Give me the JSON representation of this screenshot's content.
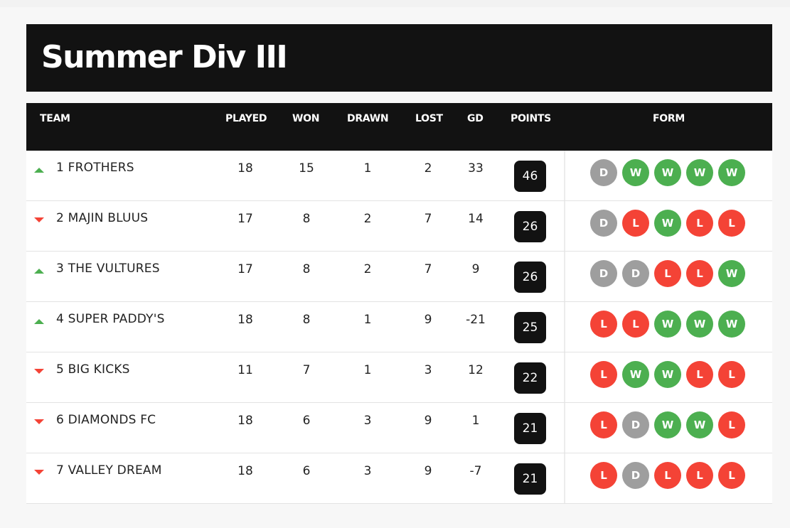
{
  "title": "Summer Div III",
  "headers": {
    "team": "TEAM",
    "played": "PLAYED",
    "won": "WON",
    "drawn": "DRAWN",
    "lost": "LOST",
    "gd": "GD",
    "points": "POINTS",
    "form": "FORM"
  },
  "colors": {
    "header_bg": "#121212",
    "win": "#4caf50",
    "loss": "#f44336",
    "draw": "#9e9e9e",
    "trend_up": "#4caf50",
    "trend_down": "#f44336"
  },
  "rows": [
    {
      "trend": "up",
      "team": "1 FROTHERS",
      "played": "18",
      "won": "15",
      "drawn": "1",
      "lost": "2",
      "gd": "33",
      "points": "46",
      "form": [
        "D",
        "W",
        "W",
        "W",
        "W"
      ]
    },
    {
      "trend": "down",
      "team": "2 MAJIN BLUUS",
      "played": "17",
      "won": "8",
      "drawn": "2",
      "lost": "7",
      "gd": "14",
      "points": "26",
      "form": [
        "D",
        "L",
        "W",
        "L",
        "L"
      ]
    },
    {
      "trend": "up",
      "team": "3 THE VULTURES",
      "played": "17",
      "won": "8",
      "drawn": "2",
      "lost": "7",
      "gd": "9",
      "points": "26",
      "form": [
        "D",
        "D",
        "L",
        "L",
        "W"
      ]
    },
    {
      "trend": "up",
      "team": "4 SUPER PADDY'S",
      "played": "18",
      "won": "8",
      "drawn": "1",
      "lost": "9",
      "gd": "-21",
      "points": "25",
      "form": [
        "L",
        "L",
        "W",
        "W",
        "W"
      ]
    },
    {
      "trend": "down",
      "team": "5 BIG KICKS",
      "played": "11",
      "won": "7",
      "drawn": "1",
      "lost": "3",
      "gd": "12",
      "points": "22",
      "form": [
        "L",
        "W",
        "W",
        "L",
        "L"
      ]
    },
    {
      "trend": "down",
      "team": "6 DIAMONDS FC",
      "played": "18",
      "won": "6",
      "drawn": "3",
      "lost": "9",
      "gd": "1",
      "points": "21",
      "form": [
        "L",
        "D",
        "W",
        "W",
        "L"
      ]
    },
    {
      "trend": "down",
      "team": "7 VALLEY DREAM",
      "played": "18",
      "won": "6",
      "drawn": "3",
      "lost": "9",
      "gd": "-7",
      "points": "21",
      "form": [
        "L",
        "D",
        "L",
        "L",
        "L"
      ]
    }
  ]
}
